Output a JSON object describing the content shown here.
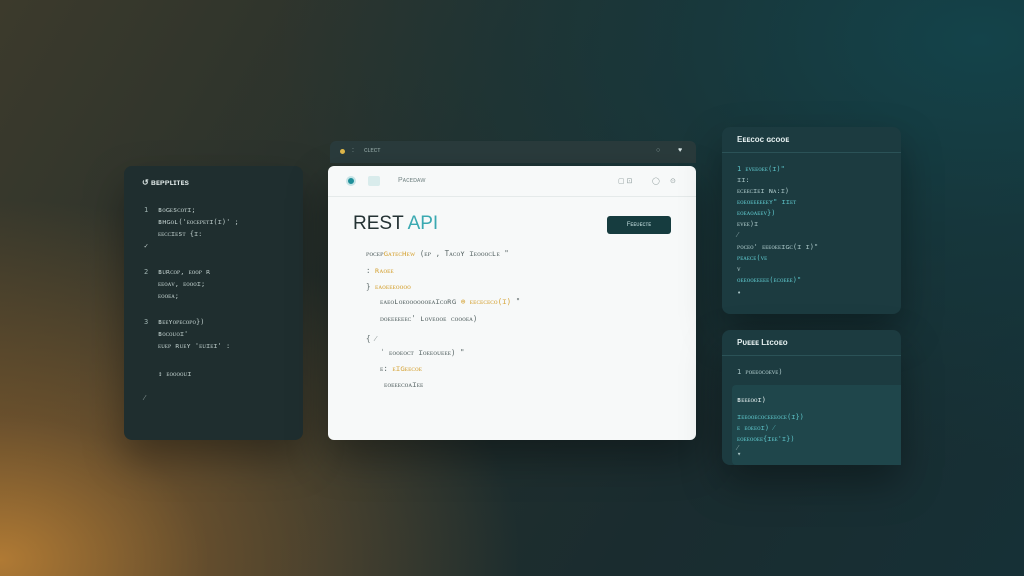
{
  "left_panel": {
    "title": "↺ ʙᴇᴘᴘʟɪᴛᴇs",
    "lines": [
      {
        "n": "1",
        "text": "ʙᴏɢᴇsᴄᴏᴛɪ;"
      },
      {
        "n": "",
        "text": "ʙʜɢᴏʟ('ᴇᴏᴄᴇᴘᴇᴛɪ(ɪ)' ;"
      },
      {
        "n": "",
        "text": "ᴇᴇᴄᴄɪᴇsᴛ {ɪ:"
      },
      {
        "n": "",
        "text": "✓"
      },
      {
        "n": "2",
        "text": "ʙᴜʀᴄᴏᴘ, ᴇᴏᴏᴘ ʀ"
      },
      {
        "n": "",
        "text": "ᴇᴇᴏᴀᴠ, ᴇᴏᴏᴏɪ;"
      },
      {
        "n": "",
        "text": "ᴇᴏᴏᴇᴀ;"
      },
      {
        "n": "3",
        "text": "ʙᴇᴇʏᴏᴘᴇᴄᴏᴘᴏ})"
      },
      {
        "n": "",
        "text": "ʙᴏᴄᴏᴜᴏɪ'"
      },
      {
        "n": "",
        "text": "ᴇᴜᴇᴘ ʀᴜᴇʏ 'ᴇᴜɪᴇɪ' :"
      },
      {
        "n": "",
        "text": "↕ ᴇᴏᴏᴏᴏᴜɪ"
      },
      {
        "n": "",
        "text": "⁄"
      }
    ]
  },
  "top_bar": {
    "label": "ᴄʟᴇᴄᴛ",
    "colon": ":",
    "icons": [
      "○",
      "♥"
    ]
  },
  "main": {
    "header_label": "Pᴀᴄᴇᴅᴀᴡ",
    "header_icons": [
      "▢ ⊡",
      "◯",
      "⊙"
    ],
    "title_main": "REST",
    "title_accent": "API",
    "button_label": "Fᴇᴇᴜᴇᴄᴛᴇ",
    "code_lines": [
      {
        "pre": "ᴘᴏᴄᴇᴘ",
        "hl": "ɢᴀᴛᴇᴄʜᴇᴡ",
        "post": " (ᴇᴘ , Tᴀᴄᴏʏ ɪᴇᴏᴏᴏᴄʟᴇ \""
      },
      {
        "pre": ": ",
        "hl": "",
        "post": "ʀᴀᴏᴇᴇ"
      },
      {
        "pre": "}  ",
        "hl": "ᴇᴀᴏᴇᴇᴇᴏᴏᴏᴏ",
        "post": ""
      },
      {
        "pre": "ᴇᴀᴇᴏʟᴏᴇᴏᴏᴏᴏᴏᴏᴇᴀɪᴄᴏʀɢ",
        "hl": " ⊕ ᴇᴇᴄᴇᴄᴇᴄᴏ(ɪ)",
        "post": " \""
      },
      {
        "pre": "ᴅᴏᴇᴇᴇᴇᴇᴇᴄ' ʟᴏᴠᴇᴏᴏᴇ ᴄᴏᴏᴏᴇᴀ)",
        "hl": "",
        "post": ""
      },
      {
        "pre": "{ ⁄",
        "hl": "",
        "post": ""
      },
      {
        "pre": "ˈ ᴇᴏᴏᴇᴏᴄᴛ ɪᴏᴇᴇᴏᴜᴇᴇᴇ) \"",
        "hl": "",
        "post": ""
      },
      {
        "pre": "ᴇ: ",
        "hl": "ᴇɪɢᴇᴇᴄᴏᴇ",
        "post": ""
      },
      {
        "pre": "",
        "hl": "ᴇᴏᴇᴇᴇᴄᴏᴀɪᴇᴇ",
        "post": ""
      }
    ]
  },
  "right_top": {
    "title": "Eᴇᴇᴄᴏᴄ ɢᴄᴏᴏᴇ",
    "lines": [
      {
        "text": "1  ᴇᴠᴇᴇᴏᴇᴇ(ɪ)\"",
        "t": true
      },
      {
        "text": "   ɪɪ:",
        "t": false
      },
      {
        "text": "   ᴇᴄᴇᴇᴄɪᴇɪ ɴᴀ:ɪ)",
        "t": false
      },
      {
        "text": "   ᴇᴏᴇᴏᴇᴇᴇᴇᴇᴇʏ\" ɪɪᴇᴛ",
        "t": true
      },
      {
        "text": "      ᴇᴏᴇᴀᴏᴀᴇᴇᴠ})",
        "t": true
      },
      {
        "text": "      ᴇᴠᴇᴇ)ɪ",
        "t": false
      },
      {
        "text": "   ⁄",
        "t": false
      },
      {
        "text": "      ᴘᴏᴄᴇᴏ' ᴇᴇᴇᴏᴇᴇɪɢᴄ(ɪ ɪ)\"",
        "t": false
      },
      {
        "text": "      ᴘᴇᴀᴇᴄᴇ(ᴠᴇ",
        "t": true
      },
      {
        "text": "   ᴠ",
        "t": false
      },
      {
        "text": "   ᴏᴇᴇᴏᴏᴇᴇᴇᴇᴇ(ᴇᴄᴏᴇᴇᴇ)\"",
        "t": true
      },
      {
        "text": "•",
        "t": false
      }
    ]
  },
  "right_bottom": {
    "title": "Pᴜᴇᴇᴇ Lɪᴄᴏᴇᴏ",
    "lines": [
      {
        "text": "1   ᴘᴏᴇᴇᴏᴄᴏᴇᴠᴇ)",
        "t": false
      },
      {
        "text": "    ʙᴇᴇᴇᴏᴏɪ)",
        "t": false
      },
      {
        "text": "    ɪᴇᴇᴏᴏᴇᴄᴏᴄᴇᴇᴇᴏᴄᴇ(ɪ})",
        "t": true
      },
      {
        "text": "    ᴇ ᴇᴏᴇᴇᴏɪ)  ⁄",
        "t": true
      },
      {
        "text": "      ᴇᴏᴇᴇᴏᴏᴇᴇ{ɪᴇᴇ'ɪ})",
        "t": true
      },
      {
        "text": "    ⁄",
        "t": false
      },
      {
        "text": "▾",
        "t": false
      }
    ]
  }
}
